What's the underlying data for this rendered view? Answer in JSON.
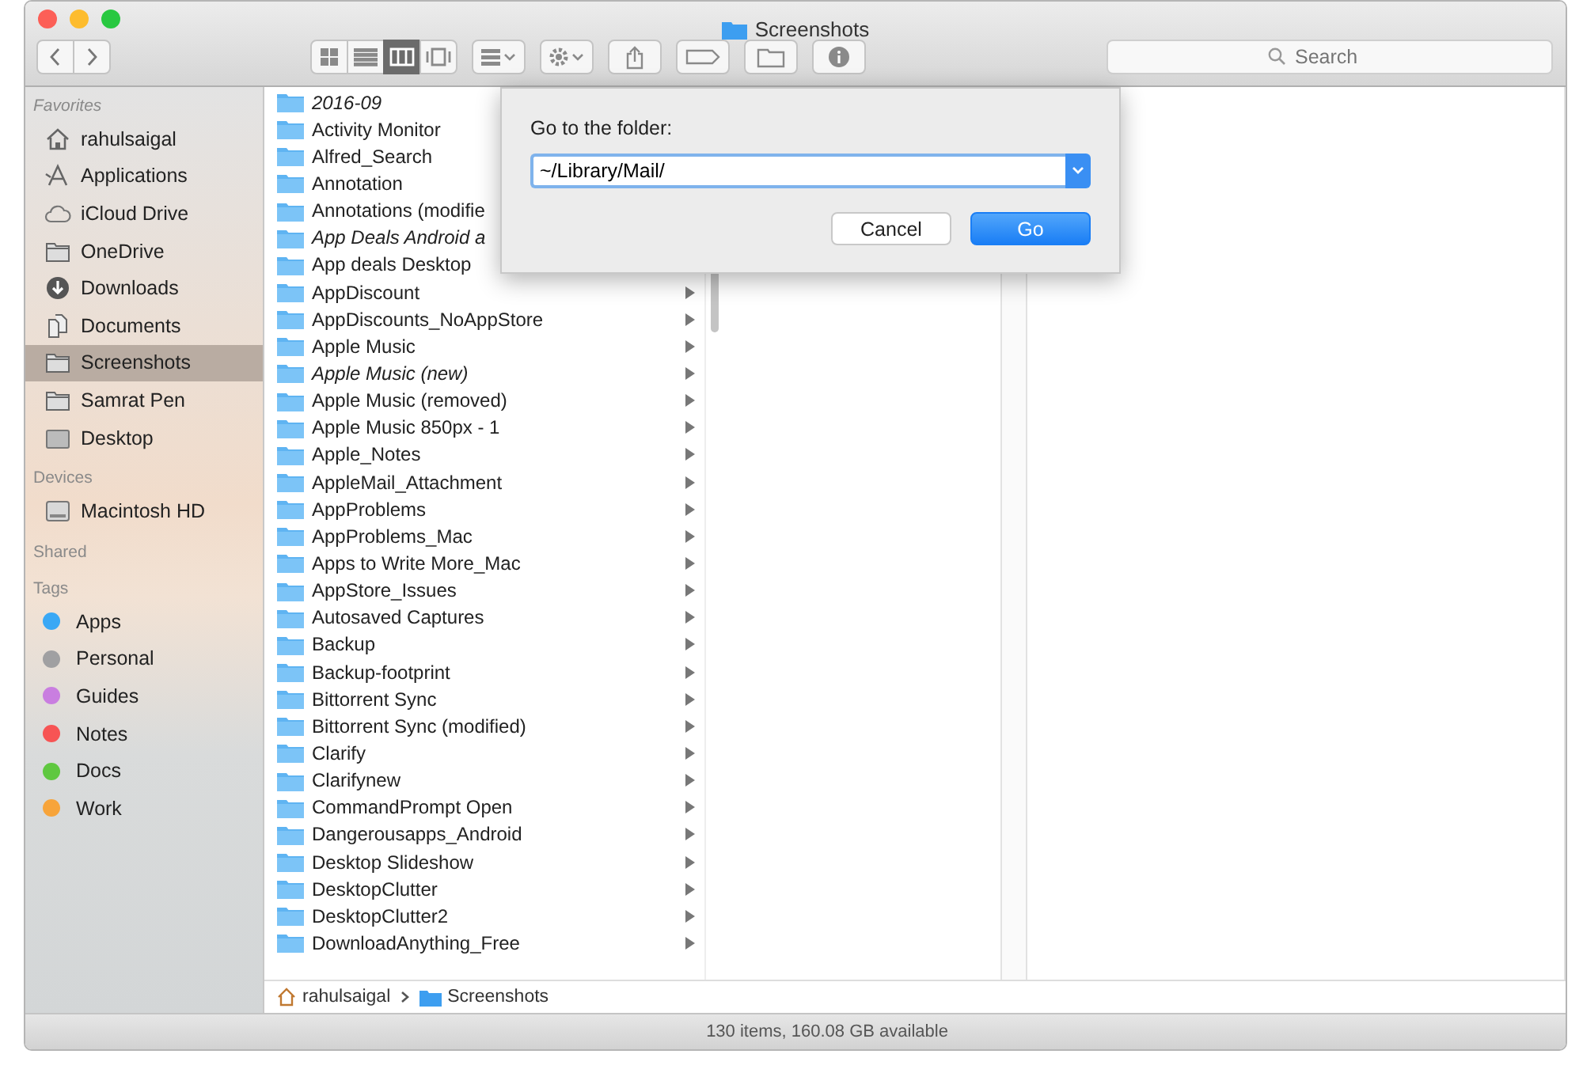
{
  "window": {
    "title": "Screenshots"
  },
  "toolbar": {
    "view_modes": [
      {
        "selected": false
      },
      {
        "selected": false
      },
      {
        "selected": true
      },
      {
        "selected": false
      }
    ],
    "search": {
      "placeholder": "Search"
    }
  },
  "sidebar": {
    "sections": [
      {
        "heading": "Favorites",
        "items": [
          {
            "label": "rahulsaigal",
            "selected": false
          },
          {
            "label": "Applications",
            "selected": false
          },
          {
            "label": "iCloud Drive",
            "selected": false
          },
          {
            "label": "OneDrive",
            "selected": false
          },
          {
            "label": "Downloads",
            "selected": false
          },
          {
            "label": "Documents",
            "selected": false
          },
          {
            "label": "Screenshots",
            "selected": true
          },
          {
            "label": "Samrat Pen",
            "selected": false
          },
          {
            "label": "Desktop",
            "selected": false
          }
        ]
      },
      {
        "heading": "Devices",
        "items": [
          {
            "label": "Macintosh HD",
            "selected": false
          }
        ]
      },
      {
        "heading": "Shared"
      },
      {
        "heading": "Tags",
        "tags": [
          {
            "label": "Apps",
            "color": "#3aa8f5"
          },
          {
            "label": "Personal",
            "color": "#a0a0a2"
          },
          {
            "label": "Guides",
            "color": "#c97ee0"
          },
          {
            "label": "Notes",
            "color": "#f75454"
          },
          {
            "label": "Docs",
            "color": "#5fc840"
          },
          {
            "label": "Work",
            "color": "#f7a43a"
          }
        ]
      }
    ]
  },
  "columns": [
    {
      "rows": [
        {
          "name": "2016-09",
          "italic": true
        },
        {
          "name": "Activity Monitor",
          "italic": false
        },
        {
          "name": "Alfred_Search",
          "italic": false
        },
        {
          "name": "Annotation",
          "italic": false
        },
        {
          "name": "Annotations (modifie",
          "italic": false
        },
        {
          "name": "App Deals Android a",
          "italic": true
        },
        {
          "name": "App deals Desktop",
          "italic": false
        },
        {
          "name": "AppDiscount",
          "italic": false,
          "arrow": true
        },
        {
          "name": "AppDiscounts_NoAppStore",
          "italic": false,
          "arrow": true
        },
        {
          "name": "Apple Music",
          "italic": false,
          "arrow": true
        },
        {
          "name": "Apple Music (new)",
          "italic": true,
          "arrow": true
        },
        {
          "name": "Apple Music (removed)",
          "italic": false,
          "arrow": true
        },
        {
          "name": "Apple Music 850px - 1",
          "italic": false,
          "arrow": true
        },
        {
          "name": "Apple_Notes",
          "italic": false,
          "arrow": true
        },
        {
          "name": "AppleMail_Attachment",
          "italic": false,
          "arrow": true
        },
        {
          "name": "AppProblems",
          "italic": false,
          "arrow": true
        },
        {
          "name": "AppProblems_Mac",
          "italic": false,
          "arrow": true
        },
        {
          "name": "Apps to Write More_Mac",
          "italic": false,
          "arrow": true
        },
        {
          "name": "AppStore_Issues",
          "italic": false,
          "arrow": true
        },
        {
          "name": "Autosaved Captures",
          "italic": false,
          "arrow": true
        },
        {
          "name": "Backup",
          "italic": false,
          "arrow": true
        },
        {
          "name": "Backup-footprint",
          "italic": false,
          "arrow": true
        },
        {
          "name": "Bittorrent Sync",
          "italic": false,
          "arrow": true
        },
        {
          "name": "Bittorrent Sync (modified)",
          "italic": false,
          "arrow": true
        },
        {
          "name": "Clarify",
          "italic": false,
          "arrow": true
        },
        {
          "name": "Clarifynew",
          "italic": false,
          "arrow": true
        },
        {
          "name": "CommandPrompt Open",
          "italic": false,
          "arrow": true
        },
        {
          "name": "Dangerousapps_Android",
          "italic": false,
          "arrow": true
        },
        {
          "name": "Desktop Slideshow",
          "italic": false,
          "arrow": true
        },
        {
          "name": "DesktopClutter",
          "italic": false,
          "arrow": true
        },
        {
          "name": "DesktopClutter2",
          "italic": false,
          "arrow": true
        },
        {
          "name": "DownloadAnything_Free",
          "italic": false,
          "arrow": true
        }
      ]
    }
  ],
  "dialog": {
    "label": "Go to the folder:",
    "value": "~/Library/Mail/",
    "buttons": [
      {
        "label": "Cancel",
        "kind": "secondary"
      },
      {
        "label": "Go",
        "kind": "primary"
      }
    ]
  },
  "path_bar": [
    "rahulsaigal",
    "Screenshots"
  ],
  "status_bar": "130 items, 160.08 GB available"
}
